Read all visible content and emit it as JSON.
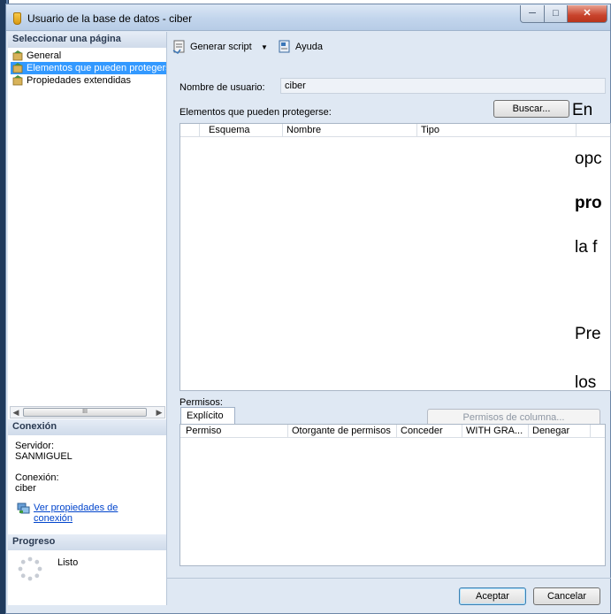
{
  "window": {
    "title": "Usuario de la base de datos - ciber",
    "minimize": "─",
    "maximize": "□",
    "close": "✕"
  },
  "sidebar": {
    "header": "Seleccionar una página",
    "items": [
      {
        "label": "General"
      },
      {
        "label": "Elementos que pueden protegerse"
      },
      {
        "label": "Propiedades extendidas"
      }
    ],
    "scroll_thumb": "III"
  },
  "connection": {
    "header": "Conexión",
    "server_label": "Servidor:",
    "server_value": "SANMIGUEL",
    "conn_label": "Conexión:",
    "conn_value": "ciber",
    "link_line1": "Ver propiedades de",
    "link_line2": "conexión"
  },
  "progress": {
    "header": "Progreso",
    "status": "Listo"
  },
  "toolbar": {
    "script": "Generar script",
    "help": "Ayuda"
  },
  "form": {
    "username_label": "Nombre de usuario:",
    "username_value": "ciber",
    "securables_label": "Elementos que pueden protegerse:",
    "search_button": "Buscar...",
    "securable_columns": [
      "Esquema",
      "Nombre",
      "Tipo"
    ],
    "permissions_label": "Permisos:",
    "column_permissions_button": "Permisos de columna...",
    "tab_explicit": "Explícito",
    "permission_columns": [
      "Permiso",
      "Otorgante de permisos",
      "Conceder",
      "WITH GRA...",
      "Denegar"
    ]
  },
  "footer": {
    "ok": "Aceptar",
    "cancel": "Cancelar"
  },
  "overlay_text": {
    "line1": "En",
    "line2": "opc",
    "line3": "pro",
    "line4": "la f",
    "line5": "Pre",
    "line6": "los"
  }
}
